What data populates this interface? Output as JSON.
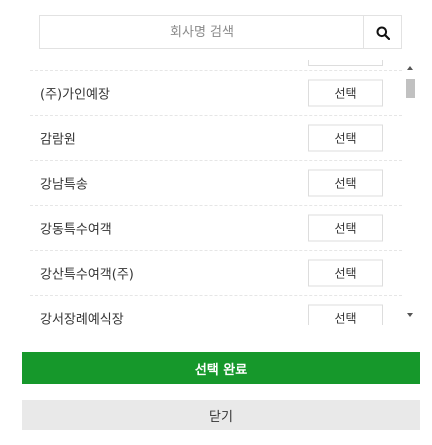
{
  "search": {
    "placeholder": "회사명 검색",
    "icon": "search-icon"
  },
  "companies": {
    "select_label": "선택",
    "items": [
      {
        "name": ""
      },
      {
        "name": "(주)가인예장"
      },
      {
        "name": "감람원"
      },
      {
        "name": "강남특송"
      },
      {
        "name": "강동특수여객"
      },
      {
        "name": "강산특수여객(주)"
      },
      {
        "name": "강서장례예식장"
      }
    ]
  },
  "footer": {
    "confirm_label": "선택 완료",
    "close_label": "닫기",
    "confirm_color": "#16982b",
    "close_color": "#e9e9e9"
  }
}
